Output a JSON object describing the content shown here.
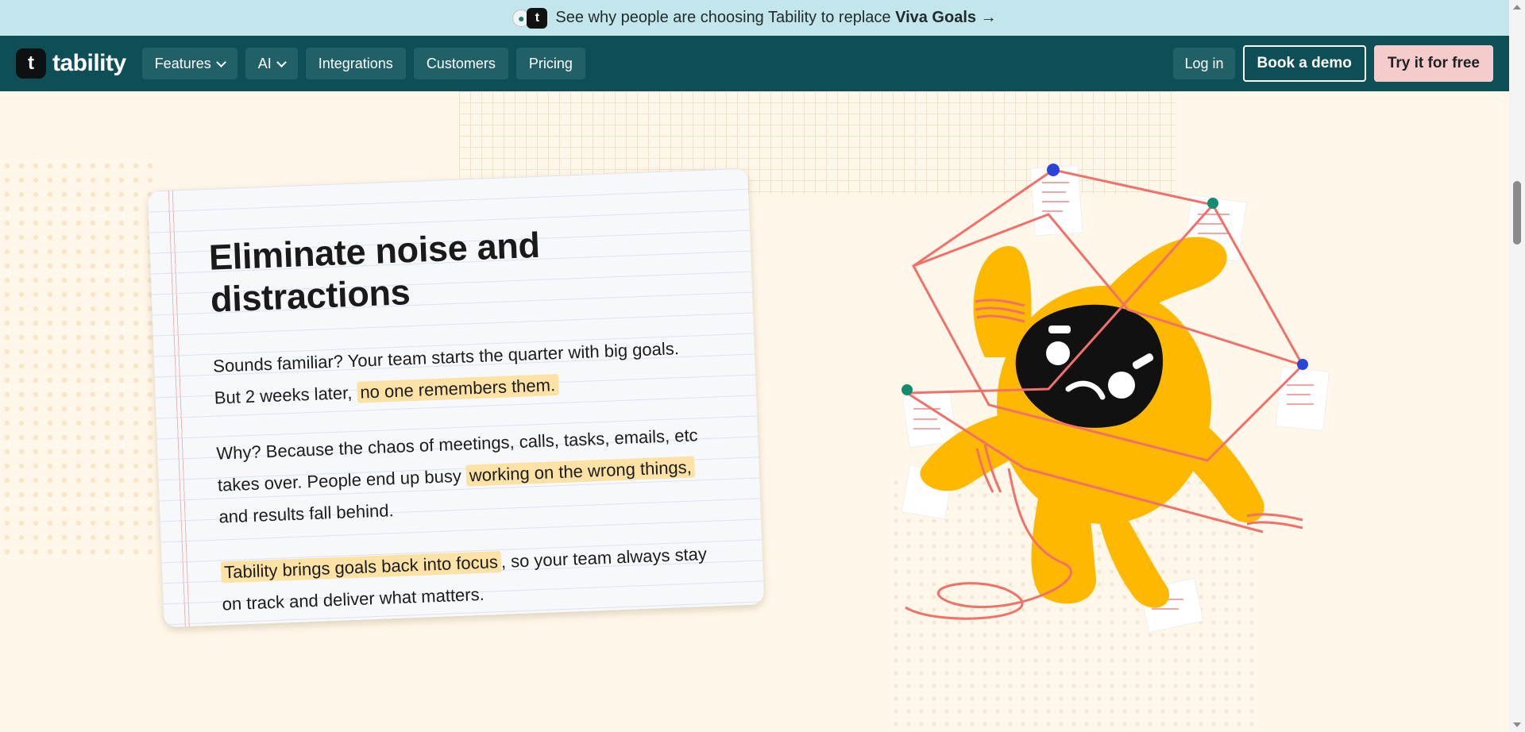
{
  "announcement": {
    "text": "See why people are choosing Tability to replace",
    "bold": "Viva Goals",
    "arrow": "→"
  },
  "nav": {
    "brand": "tability",
    "brand_mark": "t",
    "items": [
      {
        "label": "Features",
        "dropdown": true
      },
      {
        "label": "AI",
        "dropdown": true
      },
      {
        "label": "Integrations",
        "dropdown": false
      },
      {
        "label": "Customers",
        "dropdown": false
      },
      {
        "label": "Pricing",
        "dropdown": false
      }
    ],
    "login": "Log in",
    "demo": "Book a demo",
    "try": "Try it for free"
  },
  "card": {
    "title": "Eliminate noise and distractions",
    "p1_a": "Sounds familiar? Your team starts the quarter with big goals. But 2 weeks later, ",
    "p1_hl": "no one remembers them.",
    "p2_a": "Why? Because the chaos of meetings, calls, tasks, emails, etc takes over. People end up busy ",
    "p2_hl": "working on the wrong things,",
    "p2_b": " and results fall behind.",
    "p3_hl": "Tability brings goals back into focus",
    "p3_b": ", so your team always stay on track and deliver what matters."
  },
  "colors": {
    "announce_bg": "#c3e6ec",
    "nav_bg": "#0e4f57",
    "page_bg": "#fff7e9",
    "highlight": "#fde2a6",
    "mascot": "#ffb800",
    "string": "#f2706a"
  },
  "icons": [
    "water-drop-icon",
    "tability-logo-icon",
    "chevron-down-icon",
    "pin-icon"
  ]
}
